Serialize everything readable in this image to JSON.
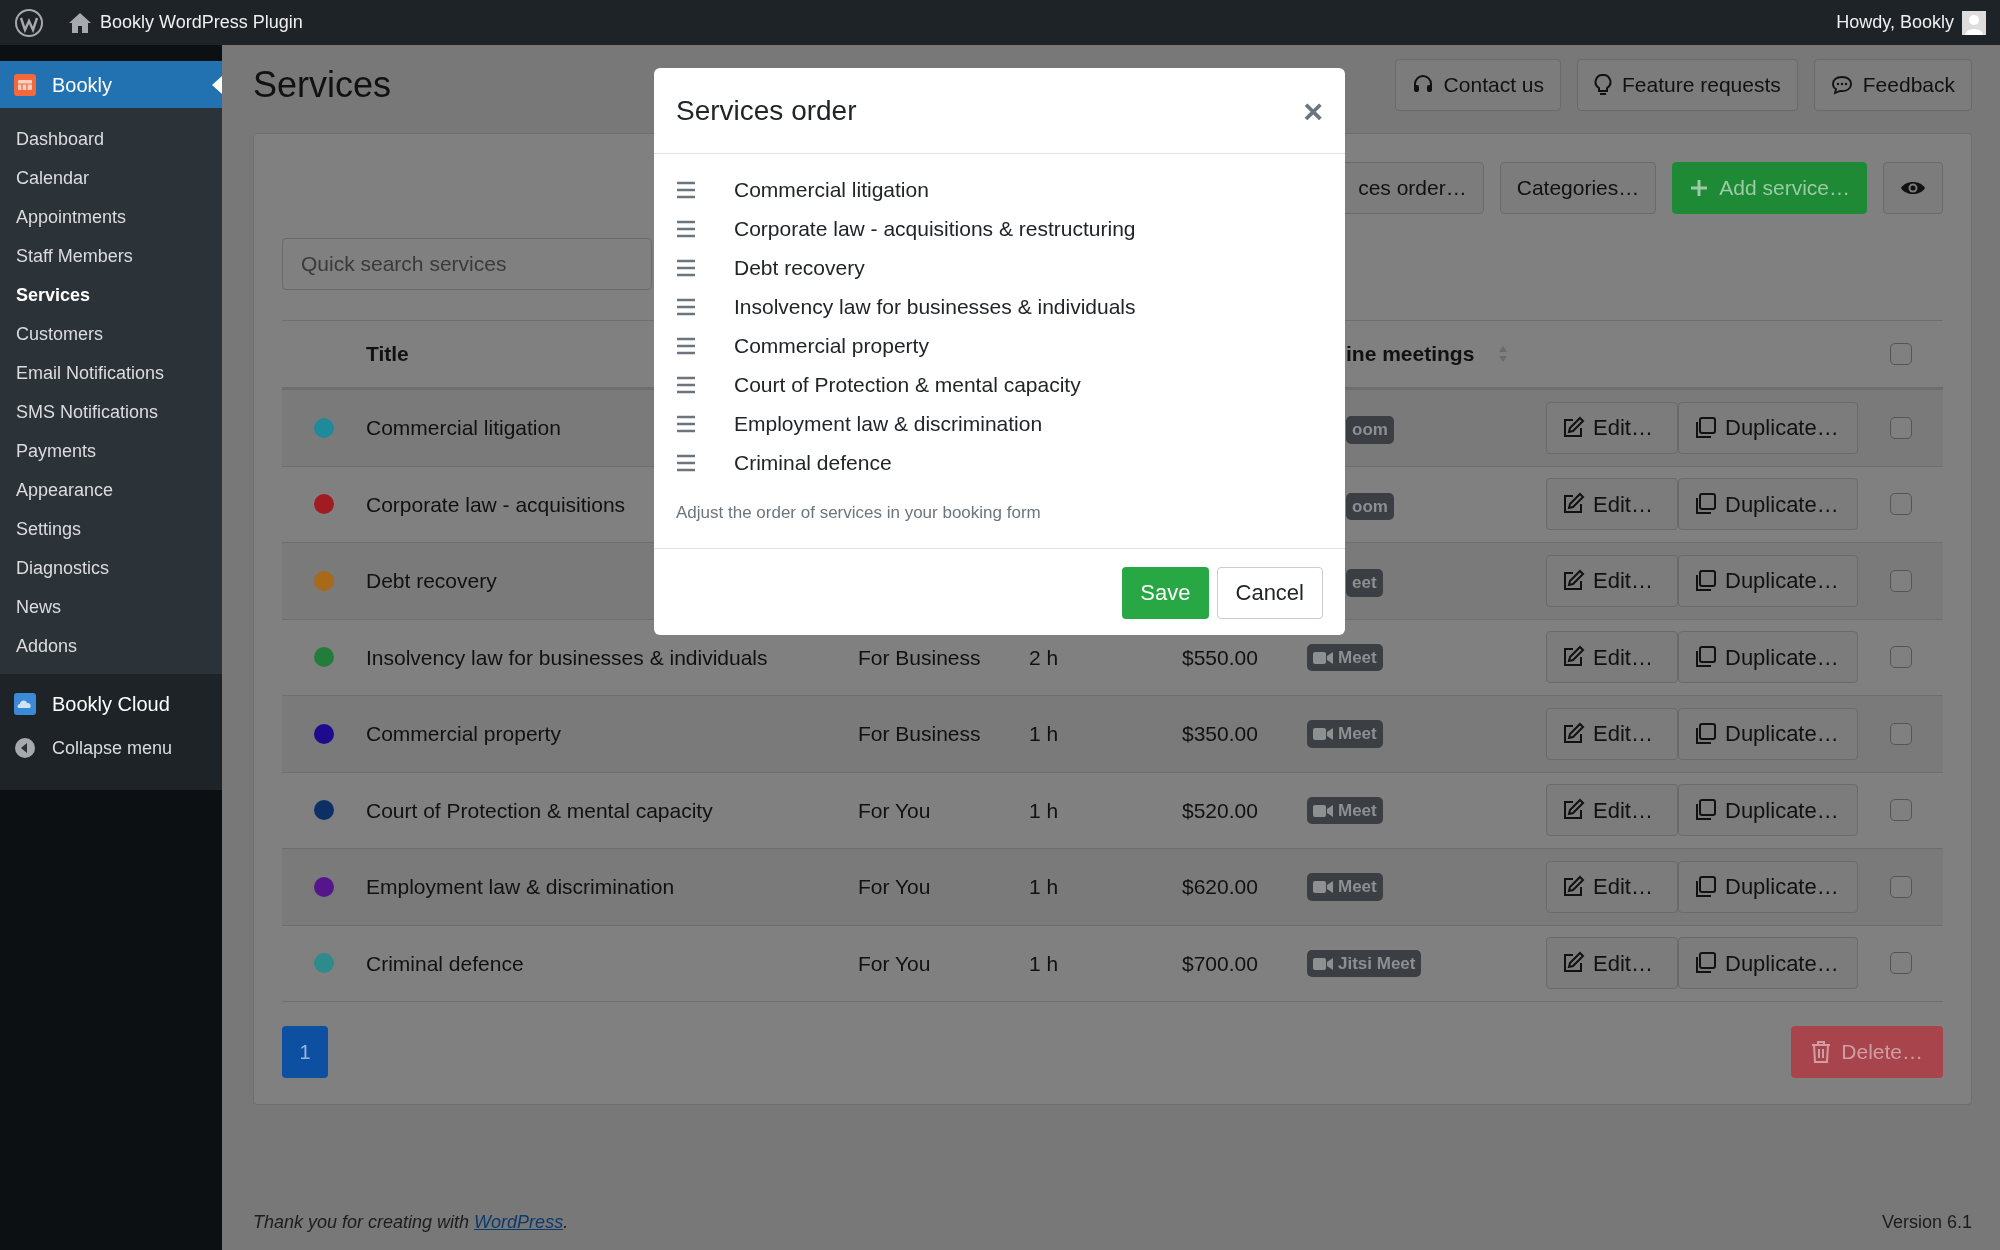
{
  "admin_bar": {
    "site_title": "Bookly WordPress Plugin",
    "greeting": "Howdy, Bookly"
  },
  "sidebar": {
    "plugin": "Bookly",
    "items": [
      {
        "label": "Dashboard",
        "selected": false
      },
      {
        "label": "Calendar",
        "selected": false
      },
      {
        "label": "Appointments",
        "selected": false
      },
      {
        "label": "Staff Members",
        "selected": false
      },
      {
        "label": "Services",
        "selected": true
      },
      {
        "label": "Customers",
        "selected": false
      },
      {
        "label": "Email Notifications",
        "selected": false
      },
      {
        "label": "SMS Notifications",
        "selected": false
      },
      {
        "label": "Payments",
        "selected": false
      },
      {
        "label": "Appearance",
        "selected": false
      },
      {
        "label": "Settings",
        "selected": false
      },
      {
        "label": "Diagnostics",
        "selected": false
      },
      {
        "label": "News",
        "selected": false
      },
      {
        "label": "Addons",
        "selected": false
      }
    ],
    "cloud": "Bookly Cloud",
    "collapse": "Collapse menu"
  },
  "page": {
    "title": "Services",
    "header_buttons": [
      {
        "label": "Contact us",
        "kind": "headset"
      },
      {
        "label": "Feature requests",
        "kind": "bulb"
      },
      {
        "label": "Feedback",
        "kind": "chat"
      }
    ],
    "toolbar_buttons": [
      {
        "label": "ces order…",
        "kind": "default"
      },
      {
        "label": "Categories…",
        "kind": "default"
      },
      {
        "label": "Add service…",
        "kind": "add"
      },
      {
        "kind": "eye"
      }
    ],
    "search": {
      "placeholder": "Quick search services"
    },
    "table": {
      "columns": [
        {
          "label": "Title"
        },
        {
          "label": "ine meetings"
        }
      ],
      "header_checked": false,
      "rows": [
        {
          "color": "#1e8a9a",
          "title": "Commercial litigation",
          "meeting": {
            "label": "oom",
            "icon": false
          },
          "edit": "Edit…",
          "duplicate": "Duplicate…",
          "checked": false
        },
        {
          "color": "#a11c22",
          "title": "Corporate law - acquisitions",
          "meeting": {
            "label": "oom",
            "icon": false
          },
          "edit": "Edit…",
          "duplicate": "Duplicate…",
          "checked": false
        },
        {
          "color": "#a8691a",
          "title": "Debt recovery",
          "meeting": {
            "label": "eet",
            "icon": false
          },
          "edit": "Edit…",
          "duplicate": "Duplicate…",
          "checked": false
        },
        {
          "color": "#237d3a",
          "title": "Insolvency law for businesses & individuals",
          "category": "For Business",
          "duration": "2 h",
          "price": "$550.00",
          "meeting": {
            "label": "Meet",
            "icon": true
          },
          "edit": "Edit…",
          "duplicate": "Duplicate…",
          "checked": false
        },
        {
          "color": "#1e0a8c",
          "title": "Commercial property",
          "category": "For Business",
          "duration": "1 h",
          "price": "$350.00",
          "meeting": {
            "label": "Meet",
            "icon": true
          },
          "edit": "Edit…",
          "duplicate": "Duplicate…",
          "checked": false
        },
        {
          "color": "#0c2f66",
          "title": "Court of Protection & mental capacity",
          "category": "For You",
          "duration": "1 h",
          "price": "$520.00",
          "meeting": {
            "label": "Meet",
            "icon": true
          },
          "edit": "Edit…",
          "duplicate": "Duplicate…",
          "checked": false
        },
        {
          "color": "#55168c",
          "title": "Employment law & discrimination",
          "category": "For You",
          "duration": "1 h",
          "price": "$620.00",
          "meeting": {
            "label": "Meet",
            "icon": true
          },
          "edit": "Edit…",
          "duplicate": "Duplicate…",
          "checked": false
        },
        {
          "color": "#2f8a8c",
          "title": "Criminal defence",
          "category": "For You",
          "duration": "1 h",
          "price": "$700.00",
          "meeting": {
            "label": "Jitsi Meet",
            "icon": true
          },
          "edit": "Edit…",
          "duplicate": "Duplicate…",
          "checked": false
        }
      ]
    },
    "pagination": [
      {
        "label": "1",
        "selected": true
      }
    ],
    "delete_button": "Delete…"
  },
  "footer": {
    "before": "Thank you for creating with ",
    "link": "WordPress",
    "after": ".",
    "version": "Version 6.1"
  },
  "modal": {
    "title": "Services order",
    "close": "×",
    "items": [
      "Commercial litigation",
      "Corporate law - acquisitions & restructuring",
      "Debt recovery",
      "Insolvency law for businesses & individuals",
      "Commercial property",
      "Court of Protection & mental capacity",
      "Employment law & discrimination",
      "Criminal defence"
    ],
    "help": "Adjust the order of services in your booking form",
    "save": "Save",
    "cancel": "Cancel"
  }
}
